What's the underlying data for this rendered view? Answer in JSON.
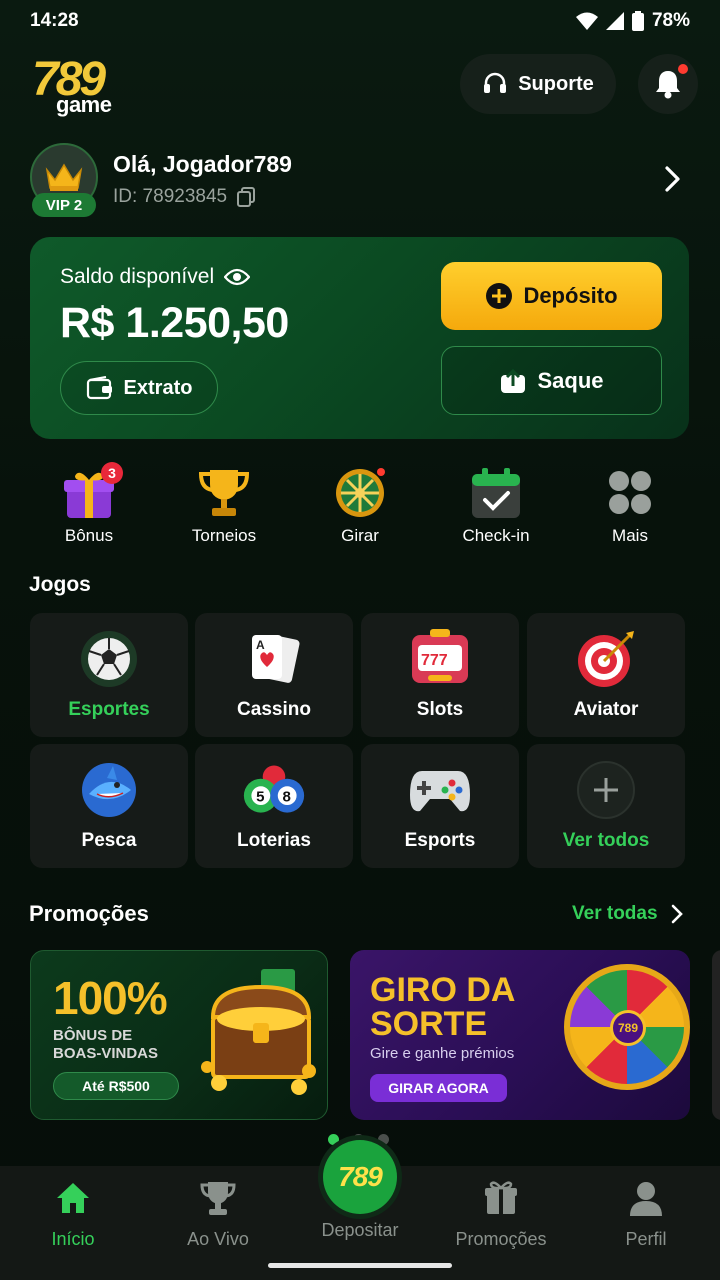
{
  "status": {
    "time": "14:28",
    "battery": "78%"
  },
  "header": {
    "logo_num": "789",
    "logo_word": "game",
    "support_label": "Suporte"
  },
  "user": {
    "greeting": "Olá, Jogador789",
    "id_text": "ID: 78923845",
    "vip": "VIP 2"
  },
  "balance": {
    "label": "Saldo disponível",
    "amount": "R$ 1.250,50",
    "extrato_label": "Extrato",
    "deposit_label": "Depósito",
    "saque_label": "Saque"
  },
  "quick_actions": [
    {
      "label": "Bônus",
      "badge": "3"
    },
    {
      "label": "Torneios"
    },
    {
      "label": "Girar"
    },
    {
      "label": "Check-in"
    },
    {
      "label": "Mais"
    }
  ],
  "games": {
    "title": "Jogos",
    "items": [
      {
        "label": "Esportes"
      },
      {
        "label": "Cassino"
      },
      {
        "label": "Slots"
      },
      {
        "label": "Aviator"
      },
      {
        "label": "Pesca"
      },
      {
        "label": "Loterias"
      },
      {
        "label": "Esports"
      },
      {
        "label": "Ver todos"
      }
    ]
  },
  "promos": {
    "title": "Promoções",
    "see_all": "Ver todas",
    "p1": {
      "big": "100%",
      "line1": "BÔNUS DE",
      "line2": "BOAS-VINDAS",
      "cta": "Até R$500"
    },
    "p2": {
      "line1": "GIRO DA",
      "line2": "SORTE",
      "sub": "Gire e ganhe prémios",
      "cta": "GIRAR AGORA",
      "wheel": "789"
    }
  },
  "nav": {
    "items": [
      {
        "label": "Início"
      },
      {
        "label": "Ao Vivo"
      },
      {
        "label": "Depositar"
      },
      {
        "label": "Promoções"
      },
      {
        "label": "Perfil"
      }
    ],
    "center_logo": "789"
  },
  "colors": {
    "accent": "#35d05a",
    "gold": "#f5b51a",
    "card": "#0f5a2a"
  }
}
